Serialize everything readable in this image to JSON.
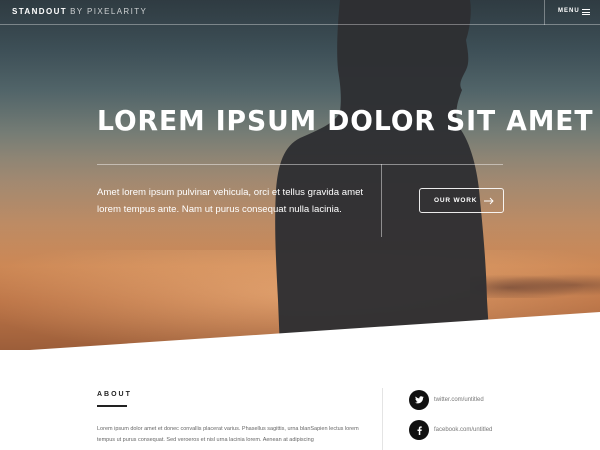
{
  "header": {
    "brand_name": "STANDOUT",
    "brand_byline": "BY PIXELARITY",
    "menu_label": "MENU",
    "menu_icon": "hamburger-icon"
  },
  "hero": {
    "headline": "LOREM IPSUM DOLOR SIT AMET",
    "text": "Amet lorem ipsum pulvinar vehicula, orci et tellus gravida amet lorem tempus ante. Nam ut purus consequat nulla lacinia.",
    "button_label": "OUR WORK",
    "button_icon": "arrow-right-icon"
  },
  "about": {
    "title": "ABOUT",
    "text": "Lorem ipsum dolor amet et donec convallis placerat varius. Phasellus sagittis, urna blanSapien lectus lorem tempus ut purus consequat. Sed veroeros et nisl urna lacinia lorem. Aenean at adipiscing"
  },
  "social": [
    {
      "icon": "twitter-icon",
      "label": "twitter.com/untitled"
    },
    {
      "icon": "facebook-icon",
      "label": "facebook.com/untitled"
    }
  ],
  "colors": {
    "text_light": "#ffffff",
    "text_dark": "#222222",
    "social_circle": "#111111"
  }
}
